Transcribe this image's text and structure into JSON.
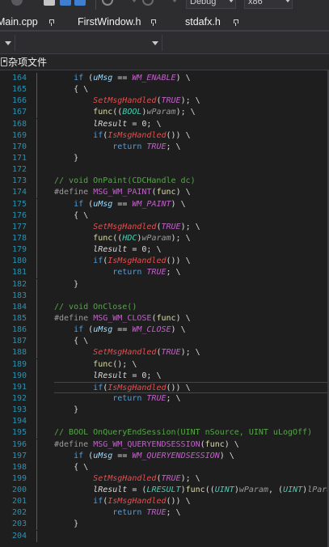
{
  "toolbar": {
    "config_combo": "Debug",
    "platform_combo": "x86"
  },
  "tabs": [
    {
      "label": "Main.cpp"
    },
    {
      "label": "FirstWindow.h"
    },
    {
      "label": "stdafx.h"
    }
  ],
  "project_selector": {
    "label": "杂项文件"
  },
  "colors": {
    "line_number": "#2b91af",
    "keyword": "#569cd6",
    "macro": "#bd63c5",
    "comment": "#57a64a",
    "function": "#dcdcaa",
    "handled": "#e05050"
  },
  "editor": {
    "current_line": 191,
    "lines": [
      {
        "n": "164",
        "tokens": [
          [
            "    ",
            "plain"
          ],
          [
            "if",
            "kw"
          ],
          [
            " (",
            "plain"
          ],
          [
            "uMsg",
            "uMsg"
          ],
          [
            " == ",
            "plain"
          ],
          [
            "WM_ENABLE",
            "macro"
          ],
          [
            ") \\",
            "plain"
          ]
        ]
      },
      {
        "n": "165",
        "tokens": [
          [
            "    { \\",
            "plain"
          ]
        ]
      },
      {
        "n": "166",
        "tokens": [
          [
            "        ",
            "plain"
          ],
          [
            "SetMsgHandled",
            "red"
          ],
          [
            "(",
            "plain"
          ],
          [
            "TRUE",
            "true"
          ],
          [
            "); \\",
            "plain"
          ]
        ]
      },
      {
        "n": "167",
        "tokens": [
          [
            "        ",
            "plain"
          ],
          [
            "func",
            "fn"
          ],
          [
            "((",
            "plain"
          ],
          [
            "BOOL",
            "type"
          ],
          [
            ")",
            "plain"
          ],
          [
            "wParam",
            "param"
          ],
          [
            "); \\",
            "plain"
          ]
        ]
      },
      {
        "n": "168",
        "tokens": [
          [
            "        ",
            "plain"
          ],
          [
            "lResult",
            "var"
          ],
          [
            " = 0; \\",
            "plain"
          ]
        ]
      },
      {
        "n": "169",
        "tokens": [
          [
            "        ",
            "plain"
          ],
          [
            "if",
            "kw"
          ],
          [
            "(",
            "plain"
          ],
          [
            "IsMsgHandled",
            "red"
          ],
          [
            "()) \\",
            "plain"
          ]
        ]
      },
      {
        "n": "170",
        "tokens": [
          [
            "            ",
            "plain"
          ],
          [
            "return",
            "kw"
          ],
          [
            " ",
            "plain"
          ],
          [
            "TRUE",
            "true"
          ],
          [
            "; \\",
            "plain"
          ]
        ]
      },
      {
        "n": "171",
        "tokens": [
          [
            "    }",
            "plain"
          ]
        ]
      },
      {
        "n": "172",
        "tokens": []
      },
      {
        "n": "173",
        "tokens": [
          [
            "// void OnPaint(CDCHandle dc)",
            "comment"
          ]
        ]
      },
      {
        "n": "174",
        "tokens": [
          [
            "#define",
            "define"
          ],
          [
            " ",
            "plain"
          ],
          [
            "MSG_WM_PAINT",
            "defname"
          ],
          [
            "(",
            "plain"
          ],
          [
            "func",
            "fn"
          ],
          [
            ") \\",
            "plain"
          ]
        ]
      },
      {
        "n": "175",
        "tokens": [
          [
            "    ",
            "plain"
          ],
          [
            "if",
            "kw"
          ],
          [
            " (",
            "plain"
          ],
          [
            "uMsg",
            "uMsg"
          ],
          [
            " == ",
            "plain"
          ],
          [
            "WM_PAINT",
            "macro"
          ],
          [
            ") \\",
            "plain"
          ]
        ]
      },
      {
        "n": "176",
        "tokens": [
          [
            "    { \\",
            "plain"
          ]
        ]
      },
      {
        "n": "177",
        "tokens": [
          [
            "        ",
            "plain"
          ],
          [
            "SetMsgHandled",
            "red"
          ],
          [
            "(",
            "plain"
          ],
          [
            "TRUE",
            "true"
          ],
          [
            "); \\",
            "plain"
          ]
        ]
      },
      {
        "n": "178",
        "tokens": [
          [
            "        ",
            "plain"
          ],
          [
            "func",
            "fn"
          ],
          [
            "((",
            "plain"
          ],
          [
            "HDC",
            "type"
          ],
          [
            ")",
            "plain"
          ],
          [
            "wParam",
            "param"
          ],
          [
            "); \\",
            "plain"
          ]
        ]
      },
      {
        "n": "179",
        "tokens": [
          [
            "        ",
            "plain"
          ],
          [
            "lResult",
            "var"
          ],
          [
            " = 0; \\",
            "plain"
          ]
        ]
      },
      {
        "n": "180",
        "tokens": [
          [
            "        ",
            "plain"
          ],
          [
            "if",
            "kw"
          ],
          [
            "(",
            "plain"
          ],
          [
            "IsMsgHandled",
            "red"
          ],
          [
            "()) \\",
            "plain"
          ]
        ]
      },
      {
        "n": "181",
        "tokens": [
          [
            "            ",
            "plain"
          ],
          [
            "return",
            "kw"
          ],
          [
            " ",
            "plain"
          ],
          [
            "TRUE",
            "true"
          ],
          [
            "; \\",
            "plain"
          ]
        ]
      },
      {
        "n": "182",
        "tokens": [
          [
            "    }",
            "plain"
          ]
        ]
      },
      {
        "n": "183",
        "tokens": []
      },
      {
        "n": "184",
        "tokens": [
          [
            "// void OnClose()",
            "comment"
          ]
        ]
      },
      {
        "n": "185",
        "tokens": [
          [
            "#define",
            "define"
          ],
          [
            " ",
            "plain"
          ],
          [
            "MSG_WM_CLOSE",
            "defname"
          ],
          [
            "(",
            "plain"
          ],
          [
            "func",
            "fn"
          ],
          [
            ") \\",
            "plain"
          ]
        ]
      },
      {
        "n": "186",
        "tokens": [
          [
            "    ",
            "plain"
          ],
          [
            "if",
            "kw"
          ],
          [
            " (",
            "plain"
          ],
          [
            "uMsg",
            "uMsg"
          ],
          [
            " == ",
            "plain"
          ],
          [
            "WM_CLOSE",
            "macro"
          ],
          [
            ") \\",
            "plain"
          ]
        ]
      },
      {
        "n": "187",
        "tokens": [
          [
            "    { \\",
            "plain"
          ]
        ]
      },
      {
        "n": "188",
        "tokens": [
          [
            "        ",
            "plain"
          ],
          [
            "SetMsgHandled",
            "red"
          ],
          [
            "(",
            "plain"
          ],
          [
            "TRUE",
            "true"
          ],
          [
            "); \\",
            "plain"
          ]
        ]
      },
      {
        "n": "189",
        "tokens": [
          [
            "        ",
            "plain"
          ],
          [
            "func",
            "fn"
          ],
          [
            "(); \\",
            "plain"
          ]
        ]
      },
      {
        "n": "190",
        "tokens": [
          [
            "        ",
            "plain"
          ],
          [
            "lResult",
            "var"
          ],
          [
            " = 0; \\",
            "plain"
          ]
        ]
      },
      {
        "n": "191",
        "tokens": [
          [
            "        ",
            "plain"
          ],
          [
            "if",
            "kw"
          ],
          [
            "(",
            "plain"
          ],
          [
            "IsMsgHandled",
            "red"
          ],
          [
            "()) \\",
            "plain"
          ]
        ]
      },
      {
        "n": "192",
        "tokens": [
          [
            "            ",
            "plain"
          ],
          [
            "return",
            "kw"
          ],
          [
            " ",
            "plain"
          ],
          [
            "TRUE",
            "true"
          ],
          [
            "; \\",
            "plain"
          ]
        ]
      },
      {
        "n": "193",
        "tokens": [
          [
            "    }",
            "plain"
          ]
        ]
      },
      {
        "n": "194",
        "tokens": []
      },
      {
        "n": "195",
        "tokens": [
          [
            "// BOOL OnQueryEndSession(UINT nSource, UINT uLogOff)",
            "comment"
          ]
        ]
      },
      {
        "n": "196",
        "tokens": [
          [
            "#define",
            "define"
          ],
          [
            " ",
            "plain"
          ],
          [
            "MSG_WM_QUERYENDSESSION",
            "defname"
          ],
          [
            "(",
            "plain"
          ],
          [
            "func",
            "fn"
          ],
          [
            ") \\",
            "plain"
          ]
        ]
      },
      {
        "n": "197",
        "tokens": [
          [
            "    ",
            "plain"
          ],
          [
            "if",
            "kw"
          ],
          [
            " (",
            "plain"
          ],
          [
            "uMsg",
            "uMsg"
          ],
          [
            " == ",
            "plain"
          ],
          [
            "WM_QUERYENDSESSION",
            "macro"
          ],
          [
            ") \\",
            "plain"
          ]
        ]
      },
      {
        "n": "198",
        "tokens": [
          [
            "    { \\",
            "plain"
          ]
        ]
      },
      {
        "n": "199",
        "tokens": [
          [
            "        ",
            "plain"
          ],
          [
            "SetMsgHandled",
            "red"
          ],
          [
            "(",
            "plain"
          ],
          [
            "TRUE",
            "true"
          ],
          [
            "); \\",
            "plain"
          ]
        ]
      },
      {
        "n": "200",
        "tokens": [
          [
            "        ",
            "plain"
          ],
          [
            "lResult",
            "var"
          ],
          [
            " = (",
            "plain"
          ],
          [
            "LRESULT",
            "type"
          ],
          [
            ")",
            "plain"
          ],
          [
            "func",
            "fn"
          ],
          [
            "((",
            "plain"
          ],
          [
            "UINT",
            "type"
          ],
          [
            ")",
            "plain"
          ],
          [
            "wParam",
            "param"
          ],
          [
            ", (",
            "plain"
          ],
          [
            "UINT",
            "type"
          ],
          [
            ")",
            "plain"
          ],
          [
            "lParam",
            "param"
          ],
          [
            ")",
            "plain"
          ]
        ]
      },
      {
        "n": "201",
        "tokens": [
          [
            "        ",
            "plain"
          ],
          [
            "if",
            "kw"
          ],
          [
            "(",
            "plain"
          ],
          [
            "IsMsgHandled",
            "red"
          ],
          [
            "()) \\",
            "plain"
          ]
        ]
      },
      {
        "n": "202",
        "tokens": [
          [
            "            ",
            "plain"
          ],
          [
            "return",
            "kw"
          ],
          [
            " ",
            "plain"
          ],
          [
            "TRUE",
            "true"
          ],
          [
            "; \\",
            "plain"
          ]
        ]
      },
      {
        "n": "203",
        "tokens": [
          [
            "    }",
            "plain"
          ]
        ]
      },
      {
        "n": "204",
        "tokens": []
      }
    ]
  }
}
